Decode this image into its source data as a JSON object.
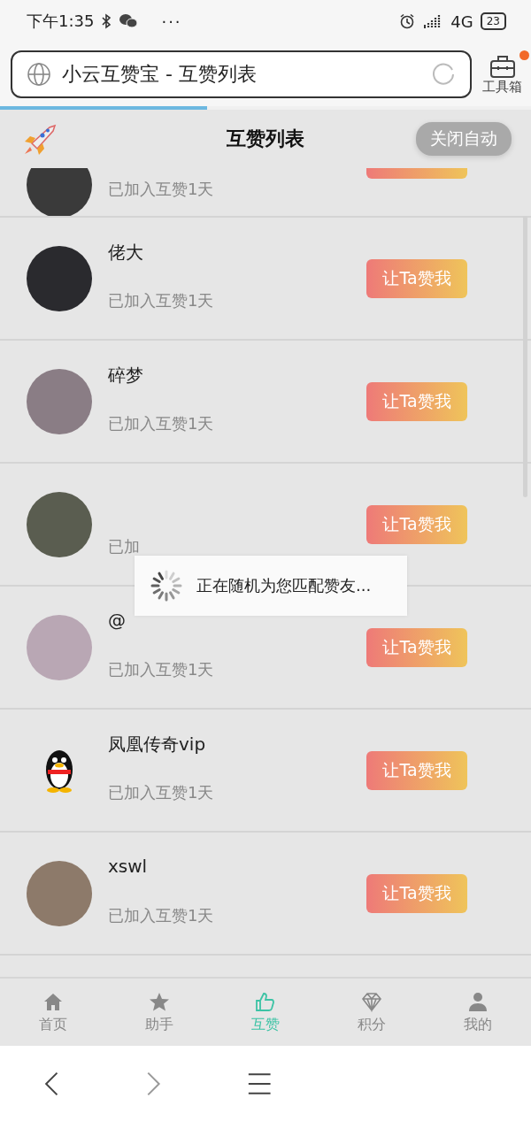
{
  "status_bar": {
    "time": "下午1:35",
    "more": "···",
    "network": "4G",
    "battery": "23"
  },
  "address_bar": {
    "title": "小云互赞宝 - 互赞列表",
    "loading": true,
    "level": 0.39
  },
  "toolbox": {
    "label": "工具箱",
    "badge": true
  },
  "header": {
    "title": "互赞列表",
    "toggle": "关闭自动"
  },
  "rows": [
    {
      "subtitle": "已加入互赞1天",
      "kind": "photo",
      "cut": true
    },
    {
      "name": "佬大",
      "subtitle": "已加入互赞1天",
      "kind": "photo",
      "button": "让Ta赞我",
      "cut": false
    },
    {
      "name": "碎梦",
      "subtitle": "已加入互赞1天",
      "kind": "photo",
      "button": "让Ta赞我",
      "cut": false
    },
    {
      "subtitle": "已加",
      "kind": "photo",
      "button": "让Ta赞我",
      "cut": false
    },
    {
      "name": "@",
      "subtitle": "已加入互赞1天",
      "kind": "photo",
      "button": "让Ta赞我",
      "cut": false
    },
    {
      "name": "凤凰传奇vip",
      "subtitle": "已加入互赞1天",
      "kind": "penguin",
      "button": "让Ta赞我",
      "cut": false
    },
    {
      "name": "xswl",
      "subtitle": "已加入互赞1天",
      "kind": "photo",
      "button": "让Ta赞我",
      "cut": false
    }
  ],
  "toast": {
    "text": "正在随机为您匹配赞友..."
  },
  "tabs": [
    {
      "label": "首页",
      "selected": false
    },
    {
      "label": "助手",
      "selected": false
    },
    {
      "label": "互赞",
      "selected": true
    },
    {
      "label": "积分",
      "selected": false
    },
    {
      "label": "我的",
      "selected": false
    }
  ]
}
